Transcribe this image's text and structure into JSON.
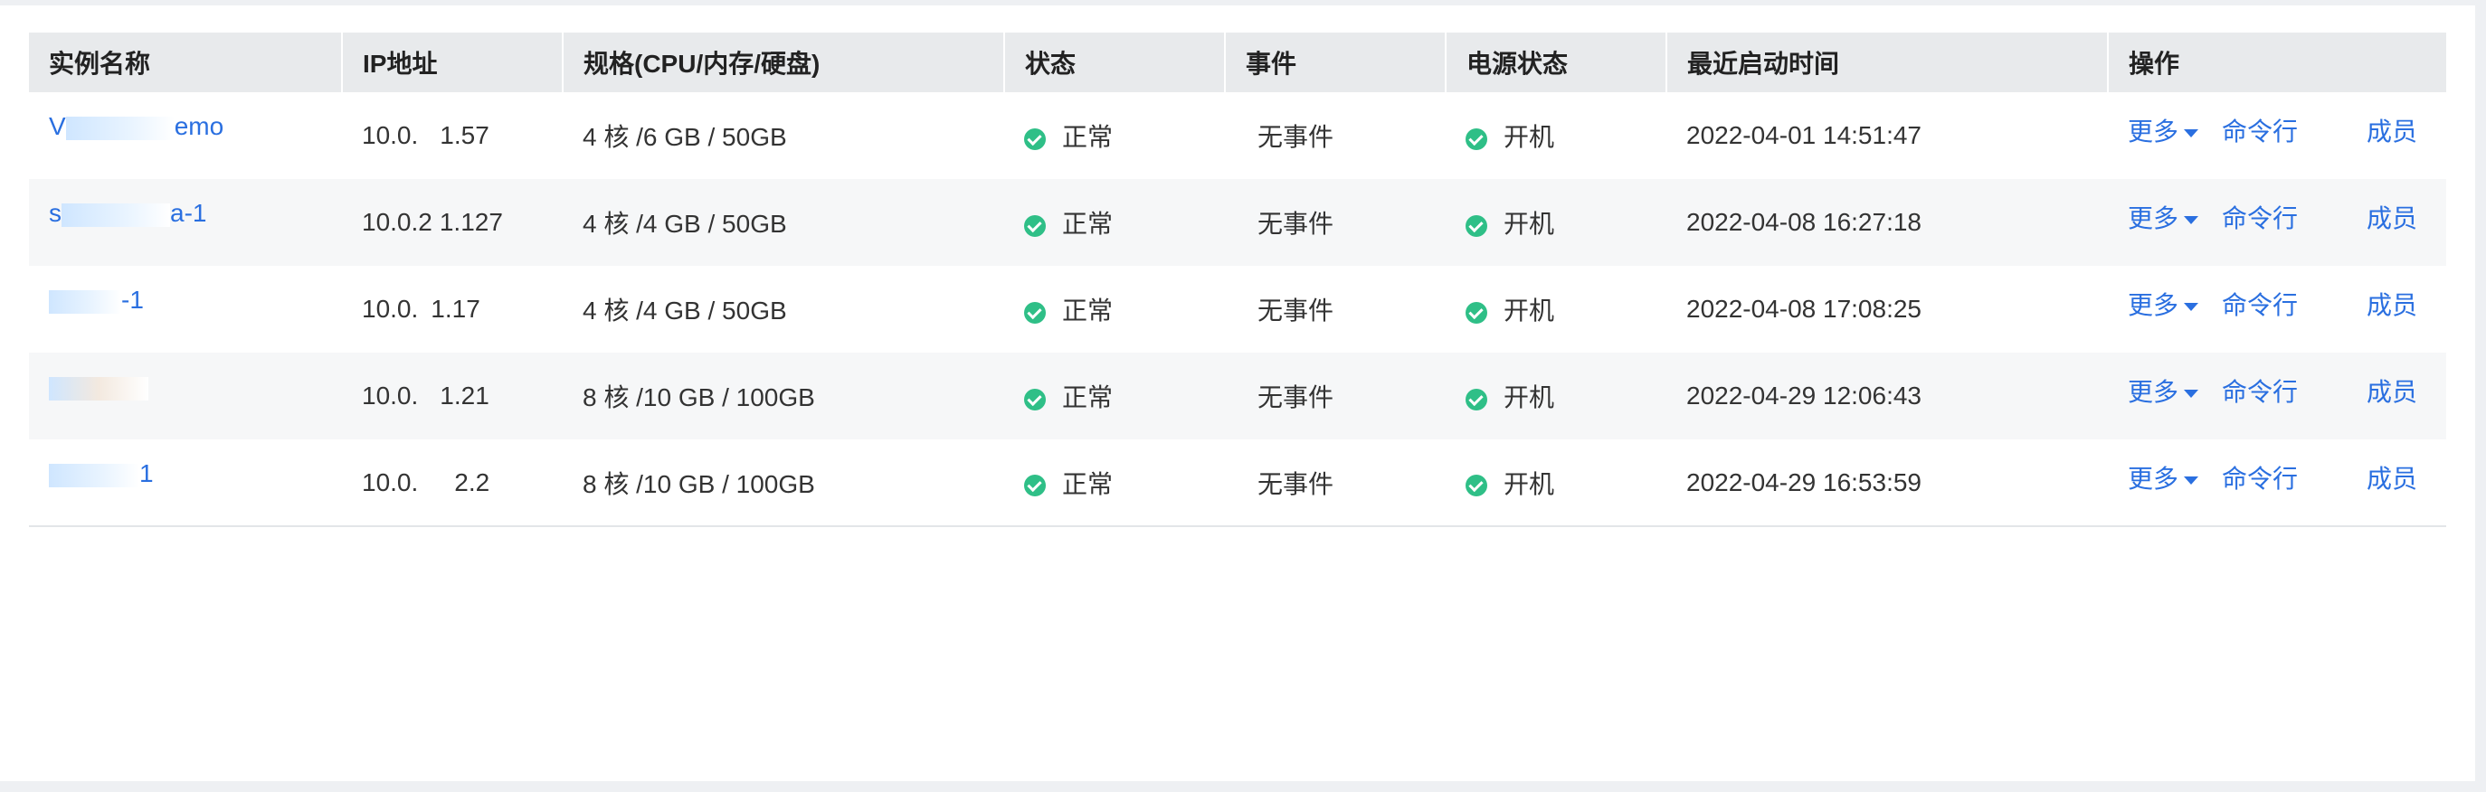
{
  "table": {
    "columns": [
      "实例名称",
      "IP地址",
      "规格(CPU/内存/硬盘)",
      "状态",
      "事件",
      "电源状态",
      "最近启动时间",
      "操作"
    ],
    "rows": [
      {
        "name_prefix": "V",
        "name_suffix": "emo",
        "ip_prefix": "10.0.",
        "ip_suffix": "1.57",
        "spec": "4 核 /6 GB / 50GB",
        "status": "正常",
        "event": "无事件",
        "power": "开机",
        "start_time": "2022-04-01 14:51:47"
      },
      {
        "name_prefix": "s",
        "name_suffix": "a-1",
        "ip_prefix": "10.0.2",
        "ip_suffix": "1.127",
        "spec": "4 核 /4 GB / 50GB",
        "status": "正常",
        "event": "无事件",
        "power": "开机",
        "start_time": "2022-04-08 16:27:18"
      },
      {
        "name_prefix": "",
        "name_suffix": "-1",
        "ip_prefix": "10.0.",
        "ip_suffix": "1.17",
        "spec": "4 核 /4 GB / 50GB",
        "status": "正常",
        "event": "无事件",
        "power": "开机",
        "start_time": "2022-04-08 17:08:25"
      },
      {
        "name_prefix": "",
        "name_suffix": "",
        "ip_prefix": "10.0.",
        "ip_suffix": "1.21",
        "spec": "8 核 /10 GB / 100GB",
        "status": "正常",
        "event": "无事件",
        "power": "开机",
        "start_time": "2022-04-29 12:06:43"
      },
      {
        "name_prefix": "",
        "name_suffix": "1",
        "ip_prefix": "10.0.",
        "ip_suffix": "2.2",
        "spec": "8 核 /10 GB / 100GB",
        "status": "正常",
        "event": "无事件",
        "power": "开机",
        "start_time": "2022-04-29 16:53:59"
      }
    ],
    "actions": {
      "more": "更多",
      "command_line": "命令行",
      "members": "成员"
    }
  },
  "colors": {
    "link": "#2a6fe0",
    "status_ok": "#2fbf87",
    "header_bg": "#e8eaec"
  }
}
